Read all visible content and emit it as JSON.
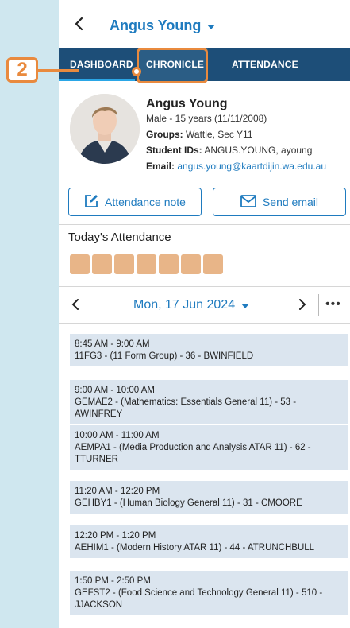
{
  "header": {
    "student_name": "Angus Young"
  },
  "tabs": [
    {
      "label": "DASHBOARD"
    },
    {
      "label": "CHRONICLE"
    },
    {
      "label": "ATTENDANCE"
    }
  ],
  "annotation": {
    "number": "2"
  },
  "profile": {
    "name": "Angus Young",
    "demographics": "Male - 15 years (11/11/2008)",
    "groups_label": "Groups:",
    "groups_value": "Wattle, Sec Y11",
    "ids_label": "Student IDs:",
    "ids_value": "ANGUS.YOUNG, ayoung",
    "email_label": "Email:",
    "email_value": "angus.young@kaartdijin.wa.edu.au"
  },
  "actions": {
    "attendance_note": "Attendance note",
    "send_email": "Send email"
  },
  "attendance": {
    "title": "Today's Attendance",
    "block_count": 7,
    "block_color": "#e8b588"
  },
  "date_nav": {
    "date": "Mon, 17 Jun 2024"
  },
  "schedule": [
    {
      "time": "8:45 AM - 9:00 AM",
      "desc": "11FG3 - (11 Form Group) - 36 - BWINFIELD"
    },
    {
      "time": "9:00 AM - 10:00 AM",
      "desc": "GEMAE2 - (Mathematics: Essentials General 11) - 53 - AWINFREY"
    },
    {
      "time": "10:00 AM - 11:00 AM",
      "desc": "AEMPA1 - (Media Production and Analysis ATAR 11) - 62 - TTURNER"
    },
    {
      "time": "11:20 AM - 12:20 PM",
      "desc": "GEHBY1 - (Human Biology General 11) - 31 - CMOORE"
    },
    {
      "time": "12:20 PM - 1:20 PM",
      "desc": "AEHIM1 - (Modern History ATAR 11) - 44 - ATRUNCHBULL"
    },
    {
      "time": "1:50 PM - 2:50 PM",
      "desc": "GEFST2 - (Food Science and Technology General 11) - 510 - JJACKSON"
    }
  ],
  "colors": {
    "brand_blue": "#1f7bbf",
    "nav_dark": "#1d4e78",
    "accent_orange": "#e98a3e",
    "schedule_bg": "#dbe5ef"
  }
}
